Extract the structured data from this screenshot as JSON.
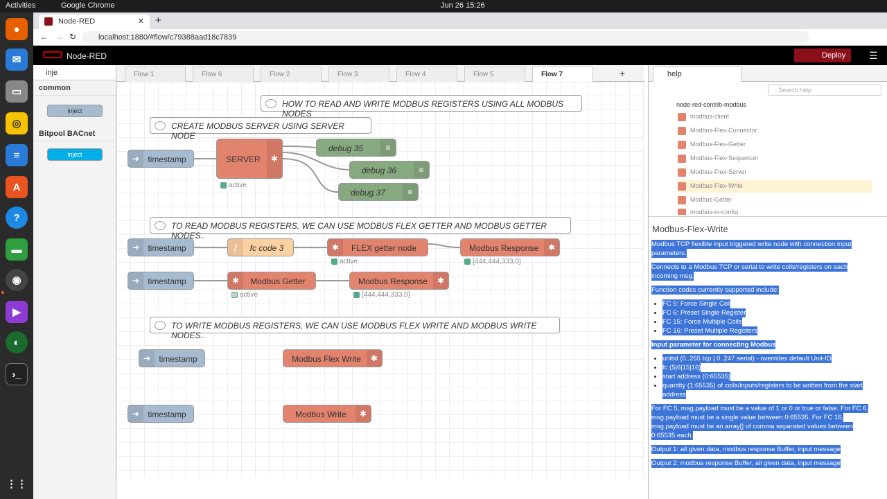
{
  "os": {
    "activities": "Activities",
    "app": "Google Chrome",
    "datetime": "Jun 26  15:26"
  },
  "browser": {
    "tab_title": "Node-RED",
    "url": "localhost:1880/#flow/c79388aad18c7839"
  },
  "header": {
    "title": "Node-RED",
    "deploy": "Deploy"
  },
  "palette": {
    "search": "inje",
    "cat1": "common",
    "cat2": "Bitpool BACnet",
    "node1": "inject",
    "node2": "inject"
  },
  "flow_tabs": [
    "Flow 1",
    "Flow 6",
    "Flow 2",
    "Flow 3",
    "Flow 4",
    "Flow 5",
    "Flow 7"
  ],
  "workspace": {
    "c1": "HOW TO READ AND WRITE MODBUS REGISTERS USING ALL MODBUS NODES",
    "c2": "CREATE MODBUS SERVER USING SERVER NODE",
    "c3": "TO READ MODBUS REGISTERS, WE CAN USE MODBUS FLEX GETTER AND MODBUS GETTER NODES..",
    "c4": "TO WRITE MODBUS REGISTERS, WE CAN USE MODBUS FLEX WRITE AND MODBUS WRITE NODES..",
    "ts": "timestamp",
    "server": "SERVER",
    "d35": "debug 35",
    "d36": "debug 36",
    "d37": "debug 37",
    "fc": "fc code 3",
    "flexgetter": "FLEX getter node",
    "resp": "Modbus Response",
    "getter": "Modbus Getter",
    "flexwrite": "Modbus Flex Write",
    "write": "Modbus Write",
    "active": "active",
    "arr": "[444,444,333,0]"
  },
  "help": {
    "tab": "help",
    "search": "Search help",
    "pkg": "node-red-contrib-modbus",
    "items": [
      "modbus-client",
      "Modbus-Flex-Connector",
      "Modbus-Flex-Getter",
      "Modbus-Flex-Sequencer",
      "Modbus-Flex-Server",
      "Modbus-Flex-Write",
      "Modbus-Getter",
      "modbus-io-config"
    ],
    "title": "Modbus-Flex-Write",
    "p1": "Modbus TCP flexible input triggered write node with connection input parameters.",
    "p2": "Connects to a Modbus TCP or serial to write coils/registers on each incoming msg.",
    "p3": "Function codes currently supported include:",
    "fcs": [
      "FC 5: Force Single Coil",
      "FC 6: Preset Single Register",
      "FC 15: Force Multiple Coils",
      "FC 16: Preset Multiple Registers"
    ],
    "p4": "Input parameter for connecting Modbus",
    "params": [
      "unitid (0..255 tcp | 0..247 serial) - overrides default Unit-ID",
      "fc (5|6|15|16)",
      "start address (0:65535)",
      "quantity (1:65535) of coils/inputs/registers to be written from the start address"
    ],
    "p5": "For FC 5, msg.payload must be a value of 1 or 0 or true or false. For FC 6, msg.payload must be a single value between 0:65535. For FC 16, msg.payload must be an array[] of comma separated values between 0:65535 each.",
    "o1": "Output 1: all given data, modbus response Buffer, input message",
    "o2": "Output 2: modbus response Buffer, all given data, input message"
  }
}
